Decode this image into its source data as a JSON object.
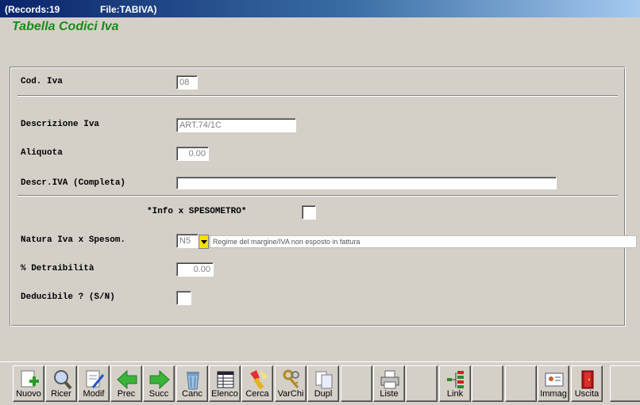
{
  "titlebar": {
    "records": "(Records:19",
    "file": "File:TABIVA)"
  },
  "app_title": "Tabella Codici Iva",
  "form": {
    "cod_iva": {
      "label": "Cod. Iva",
      "value": "08"
    },
    "descrizione": {
      "label": "Descrizione Iva",
      "value": "ART.74/1C"
    },
    "aliquota": {
      "label": "Aliquota",
      "value": "0.00"
    },
    "descr_completa": {
      "label": "Descr.IVA (Completa)",
      "value": ""
    },
    "info_spesometro": {
      "label": "*Info x SPESOMETRO*",
      "checked": false
    },
    "natura": {
      "label": "Natura Iva x Spesom.",
      "value": "N5",
      "description": "Regime del margine/IVA non esposto in fattura"
    },
    "detraibilita": {
      "label": "% Detraibilità",
      "value": "0.00"
    },
    "deducibile": {
      "label": "Deducibile ? (S/N)",
      "value": ""
    }
  },
  "toolbar": {
    "buttons": [
      {
        "label": "Nuovo",
        "icon": "new-document-icon"
      },
      {
        "label": "Ricer",
        "icon": "magnifier-icon"
      },
      {
        "label": "Modif",
        "icon": "edit-document-icon"
      },
      {
        "label": "Prec",
        "icon": "arrow-left-icon"
      },
      {
        "label": "Succ",
        "icon": "arrow-right-icon"
      },
      {
        "label": "Canc",
        "icon": "trash-icon"
      },
      {
        "label": "Elenco",
        "icon": "list-table-icon"
      },
      {
        "label": "Cerca",
        "icon": "flashlight-icon"
      },
      {
        "label": "VarChi",
        "icon": "keys-icon"
      },
      {
        "label": "Dupl",
        "icon": "duplicate-icon"
      },
      {
        "label": "",
        "icon": ""
      },
      {
        "label": "Liste",
        "icon": "printer-icon"
      },
      {
        "label": "",
        "icon": ""
      },
      {
        "label": "Link",
        "icon": "tree-link-icon"
      },
      {
        "label": "",
        "icon": ""
      },
      {
        "label": "",
        "icon": ""
      },
      {
        "label": "Immag",
        "icon": "image-card-icon"
      },
      {
        "label": "Uscita",
        "icon": "exit-door-icon"
      },
      {
        "label": "",
        "icon": ""
      }
    ]
  },
  "colors": {
    "titlebar": "#0a246a",
    "title_text": "#1a8a1a",
    "combo_button": "#f5e000"
  }
}
